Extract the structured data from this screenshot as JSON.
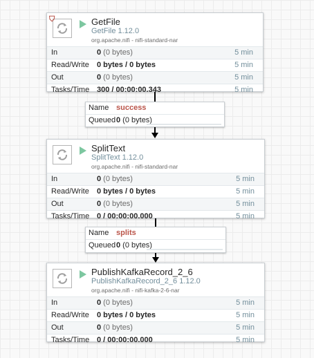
{
  "processors": [
    {
      "name": "GetFile",
      "type": "GetFile 1.12.0",
      "bundle": "org.apache.nifi - nifi-standard-nar",
      "restricted": true,
      "stats": [
        {
          "label": "In",
          "value_bold": "0",
          "value_rest": " (0 bytes)",
          "time": "5 min"
        },
        {
          "label": "Read/Write",
          "value_bold": "0 bytes / 0 bytes",
          "value_rest": "",
          "time": "5 min"
        },
        {
          "label": "Out",
          "value_bold": "0",
          "value_rest": " (0 bytes)",
          "time": "5 min"
        },
        {
          "label": "Tasks/Time",
          "value_bold": "300 / 00:00:00.343",
          "value_rest": "",
          "time": "5 min"
        }
      ]
    },
    {
      "name": "SplitText",
      "type": "SplitText 1.12.0",
      "bundle": "org.apache.nifi - nifi-standard-nar",
      "restricted": false,
      "stats": [
        {
          "label": "In",
          "value_bold": "0",
          "value_rest": " (0 bytes)",
          "time": "5 min"
        },
        {
          "label": "Read/Write",
          "value_bold": "0 bytes / 0 bytes",
          "value_rest": "",
          "time": "5 min"
        },
        {
          "label": "Out",
          "value_bold": "0",
          "value_rest": " (0 bytes)",
          "time": "5 min"
        },
        {
          "label": "Tasks/Time",
          "value_bold": "0 / 00:00:00.000",
          "value_rest": "",
          "time": "5 min"
        }
      ]
    },
    {
      "name": "PublishKafkaRecord_2_6",
      "type": "PublishKafkaRecord_2_6 1.12.0",
      "bundle": "org.apache.nifi - nifi-kafka-2-6-nar",
      "restricted": false,
      "stats": [
        {
          "label": "In",
          "value_bold": "0",
          "value_rest": " (0 bytes)",
          "time": "5 min"
        },
        {
          "label": "Read/Write",
          "value_bold": "0 bytes / 0 bytes",
          "value_rest": "",
          "time": "5 min"
        },
        {
          "label": "Out",
          "value_bold": "0",
          "value_rest": " (0 bytes)",
          "time": "5 min"
        },
        {
          "label": "Tasks/Time",
          "value_bold": "0 / 00:00:00.000",
          "value_rest": "",
          "time": "5 min"
        }
      ]
    }
  ],
  "connections": [
    {
      "name_label": "Name",
      "relationship": "success",
      "queued_label": "Queued",
      "queued_count": "0",
      "queued_rest": " (0 bytes)"
    },
    {
      "name_label": "Name",
      "relationship": "splits",
      "queued_label": "Queued",
      "queued_count": "0",
      "queued_rest": " (0 bytes)"
    }
  ],
  "colors": {
    "run_icon": "#7dc7a0",
    "relationship": "#ba554a",
    "secondary_text": "#728e9b",
    "restricted_badge": "#ba554a"
  },
  "icons": [
    "restricted-shield-icon",
    "processor-icon",
    "run-status-icon"
  ]
}
